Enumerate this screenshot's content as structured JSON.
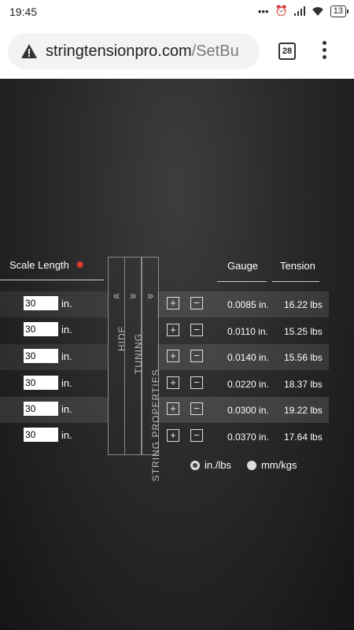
{
  "status": {
    "time": "19:45",
    "battery": "13",
    "dots": "•••"
  },
  "browser": {
    "url_domain": "stringtensionpro.com",
    "url_path": "/SetBu",
    "tab_count": "28"
  },
  "scale": {
    "header": "Scale Length",
    "unit": "in.",
    "values": [
      "30",
      "30",
      "30",
      "30",
      "30",
      "30"
    ]
  },
  "tabs": {
    "hide": "HIDE",
    "tuning": "TUNING",
    "string_properties": "STRING PROPERTIES",
    "arrow_left": "«",
    "arrow_right": "»"
  },
  "table": {
    "gauge_header": "Gauge",
    "tension_header": "Tension",
    "plus": "+",
    "minus": "−",
    "rows": [
      {
        "gauge": "0.0085 in.",
        "tension": "16.22 lbs"
      },
      {
        "gauge": "0.0110 in.",
        "tension": "15.25 lbs"
      },
      {
        "gauge": "0.0140 in.",
        "tension": "15.56 lbs"
      },
      {
        "gauge": "0.0220 in.",
        "tension": "18.37 lbs"
      },
      {
        "gauge": "0.0300 in.",
        "tension": "19.22 lbs"
      },
      {
        "gauge": "0.0370 in.",
        "tension": "17.64 lbs"
      }
    ]
  },
  "units": {
    "option1": "in./lbs",
    "option2": "mm/kgs",
    "selected": "in./lbs"
  }
}
